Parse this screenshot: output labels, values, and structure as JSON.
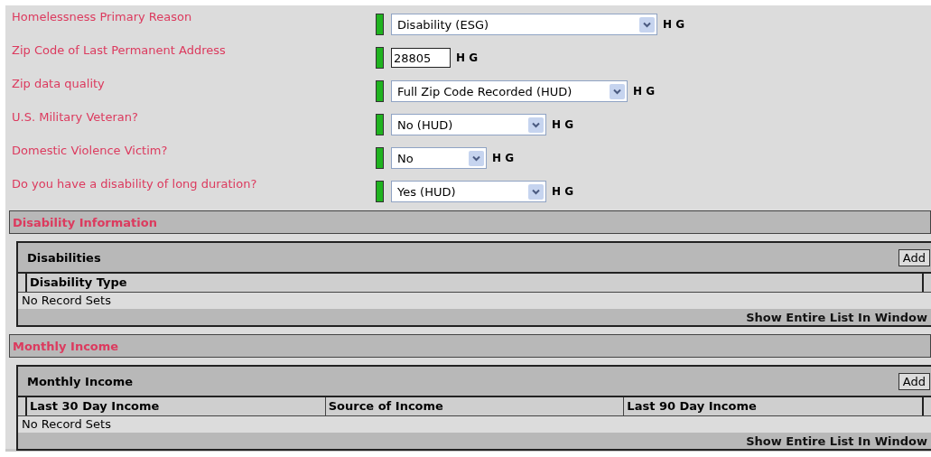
{
  "fields": [
    {
      "label": "Homelessness Primary Reason",
      "kind": "select",
      "value": "Disability (ESG)",
      "flags": "H G"
    },
    {
      "label": "Zip Code of Last Permanent Address",
      "kind": "text",
      "value": "28805",
      "flags": "H G"
    },
    {
      "label": "Zip data quality",
      "kind": "select",
      "value": "Full Zip Code Recorded (HUD)",
      "flags": "H G"
    },
    {
      "label": "U.S. Military Veteran?",
      "kind": "select",
      "value": "No (HUD)",
      "flags": "H G"
    },
    {
      "label": "Domestic Violence Victim?",
      "kind": "select",
      "value": "No",
      "flags": "H G"
    },
    {
      "label": "Do you have a disability of long duration?",
      "kind": "select",
      "value": "Yes (HUD)",
      "flags": "H G"
    }
  ],
  "sections": [
    {
      "title": "Disability Information",
      "panel": {
        "title": "Disabilities",
        "add_button": "Add",
        "columns": [
          "Disability Type"
        ],
        "empty_text": "No Record Sets",
        "footer_link": "Show Entire List In Window"
      }
    },
    {
      "title": "Monthly Income",
      "panel": {
        "title": "Monthly Income",
        "add_button": "Add",
        "columns": [
          "Last 30 Day Income",
          "Source of Income",
          "Last 90 Day Income"
        ],
        "empty_text": "No Record Sets",
        "footer_link": "Show Entire List In Window"
      }
    }
  ]
}
